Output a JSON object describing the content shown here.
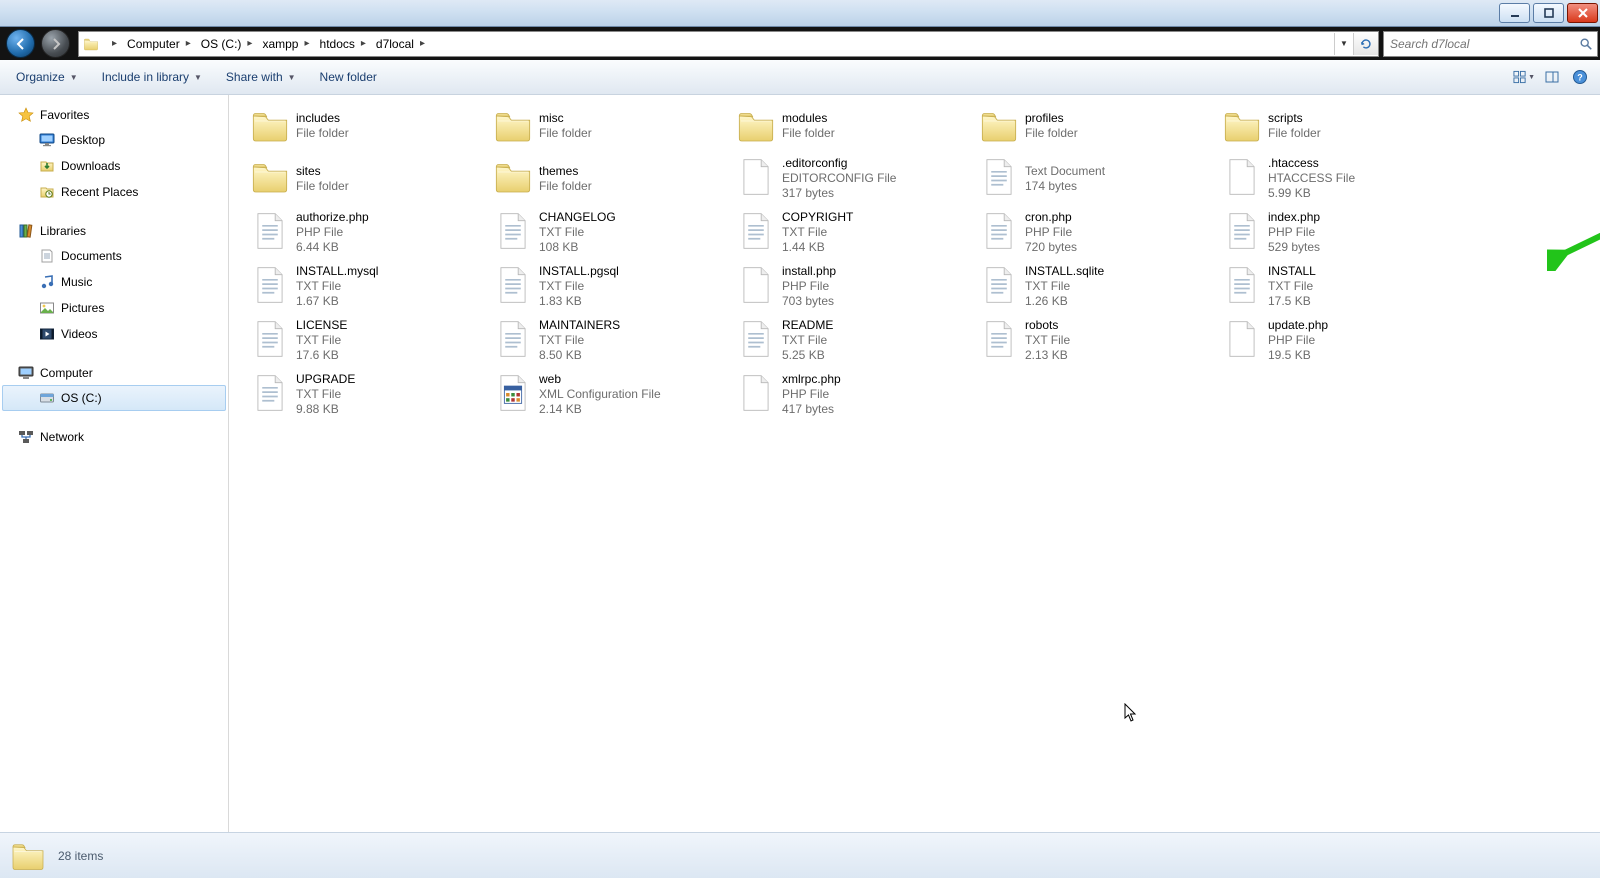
{
  "window": {
    "minimize": "minimize",
    "maximize": "maximize",
    "close": "close"
  },
  "breadcrumb": [
    "Computer",
    "OS (C:)",
    "xampp",
    "htdocs",
    "d7local"
  ],
  "search": {
    "placeholder": "Search d7local"
  },
  "toolbar": {
    "organize": "Organize",
    "include": "Include in library",
    "share": "Share with",
    "newfolder": "New folder"
  },
  "sidebar": {
    "favorites": {
      "label": "Favorites",
      "items": [
        "Desktop",
        "Downloads",
        "Recent Places"
      ]
    },
    "libraries": {
      "label": "Libraries",
      "items": [
        "Documents",
        "Music",
        "Pictures",
        "Videos"
      ]
    },
    "computer": {
      "label": "Computer",
      "items": [
        "OS (C:)"
      ]
    },
    "network": {
      "label": "Network"
    }
  },
  "files": [
    {
      "name": "includes",
      "type": "File folder",
      "size": "",
      "kind": "folder"
    },
    {
      "name": "misc",
      "type": "File folder",
      "size": "",
      "kind": "folder"
    },
    {
      "name": "modules",
      "type": "File folder",
      "size": "",
      "kind": "folder"
    },
    {
      "name": "profiles",
      "type": "File folder",
      "size": "",
      "kind": "folder"
    },
    {
      "name": "scripts",
      "type": "File folder",
      "size": "",
      "kind": "folder"
    },
    {
      "name": "sites",
      "type": "File folder",
      "size": "",
      "kind": "folder"
    },
    {
      "name": "themes",
      "type": "File folder",
      "size": "",
      "kind": "folder"
    },
    {
      "name": ".editorconfig",
      "type": "EDITORCONFIG File",
      "size": "317 bytes",
      "kind": "blank"
    },
    {
      "name": "",
      "type": "Text Document",
      "size": "174 bytes",
      "kind": "txt"
    },
    {
      "name": ".htaccess",
      "type": "HTACCESS File",
      "size": "5.99 KB",
      "kind": "blank"
    },
    {
      "name": "authorize.php",
      "type": "PHP File",
      "size": "6.44 KB",
      "kind": "txt"
    },
    {
      "name": "CHANGELOG",
      "type": "TXT File",
      "size": "108 KB",
      "kind": "txt"
    },
    {
      "name": "COPYRIGHT",
      "type": "TXT File",
      "size": "1.44 KB",
      "kind": "txt"
    },
    {
      "name": "cron.php",
      "type": "PHP File",
      "size": "720 bytes",
      "kind": "txt"
    },
    {
      "name": "index.php",
      "type": "PHP File",
      "size": "529 bytes",
      "kind": "txt"
    },
    {
      "name": "INSTALL.mysql",
      "type": "TXT File",
      "size": "1.67 KB",
      "kind": "txt"
    },
    {
      "name": "INSTALL.pgsql",
      "type": "TXT File",
      "size": "1.83 KB",
      "kind": "txt"
    },
    {
      "name": "install.php",
      "type": "PHP File",
      "size": "703 bytes",
      "kind": "blank"
    },
    {
      "name": "INSTALL.sqlite",
      "type": "TXT File",
      "size": "1.26 KB",
      "kind": "txt"
    },
    {
      "name": "INSTALL",
      "type": "TXT File",
      "size": "17.5 KB",
      "kind": "txt"
    },
    {
      "name": "LICENSE",
      "type": "TXT File",
      "size": "17.6 KB",
      "kind": "txt"
    },
    {
      "name": "MAINTAINERS",
      "type": "TXT File",
      "size": "8.50 KB",
      "kind": "txt"
    },
    {
      "name": "README",
      "type": "TXT File",
      "size": "5.25 KB",
      "kind": "txt"
    },
    {
      "name": "robots",
      "type": "TXT File",
      "size": "2.13 KB",
      "kind": "txt"
    },
    {
      "name": "update.php",
      "type": "PHP File",
      "size": "19.5 KB",
      "kind": "blank"
    },
    {
      "name": "UPGRADE",
      "type": "TXT File",
      "size": "9.88 KB",
      "kind": "txt"
    },
    {
      "name": "web",
      "type": "XML Configuration File",
      "size": "2.14 KB",
      "kind": "xml"
    },
    {
      "name": "xmlrpc.php",
      "type": "PHP File",
      "size": "417 bytes",
      "kind": "blank"
    }
  ],
  "status": {
    "count": "28 items"
  },
  "sidebar_selected": "OS (C:)"
}
